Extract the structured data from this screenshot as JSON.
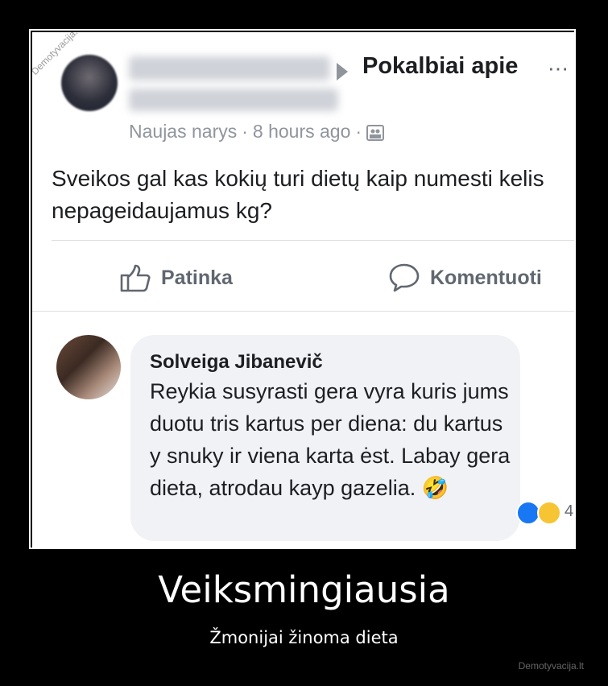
{
  "post": {
    "group_title": "Pokalbiai apie",
    "more_icon": "more-horizontal-icon",
    "meta": {
      "member": "Naujas narys",
      "time": "8 hours ago",
      "privacy_icon": "group-privacy-icon"
    },
    "text": "Sveikos gal kas kokių turi dietų kaip numesti kelis nepageidaujamus kg?",
    "actions": {
      "like": "Patinka",
      "comment": "Komentuoti"
    }
  },
  "comment": {
    "author": "Solveiga Jibanevič",
    "text": "Reykia susyrasti gera vyra kuris jums duotu tris kartus per diena: du kartus y snuky ir viena karta ėst. Labay gera dieta, atrodau kayp gazelia. 🤣",
    "reaction_count": "4"
  },
  "poster": {
    "title": "Veiksmingiausia",
    "subtitle": "Žmonijai žinoma dieta",
    "site": "Demotyvacija.lt",
    "watermark": "Demotyvacija.lt"
  }
}
